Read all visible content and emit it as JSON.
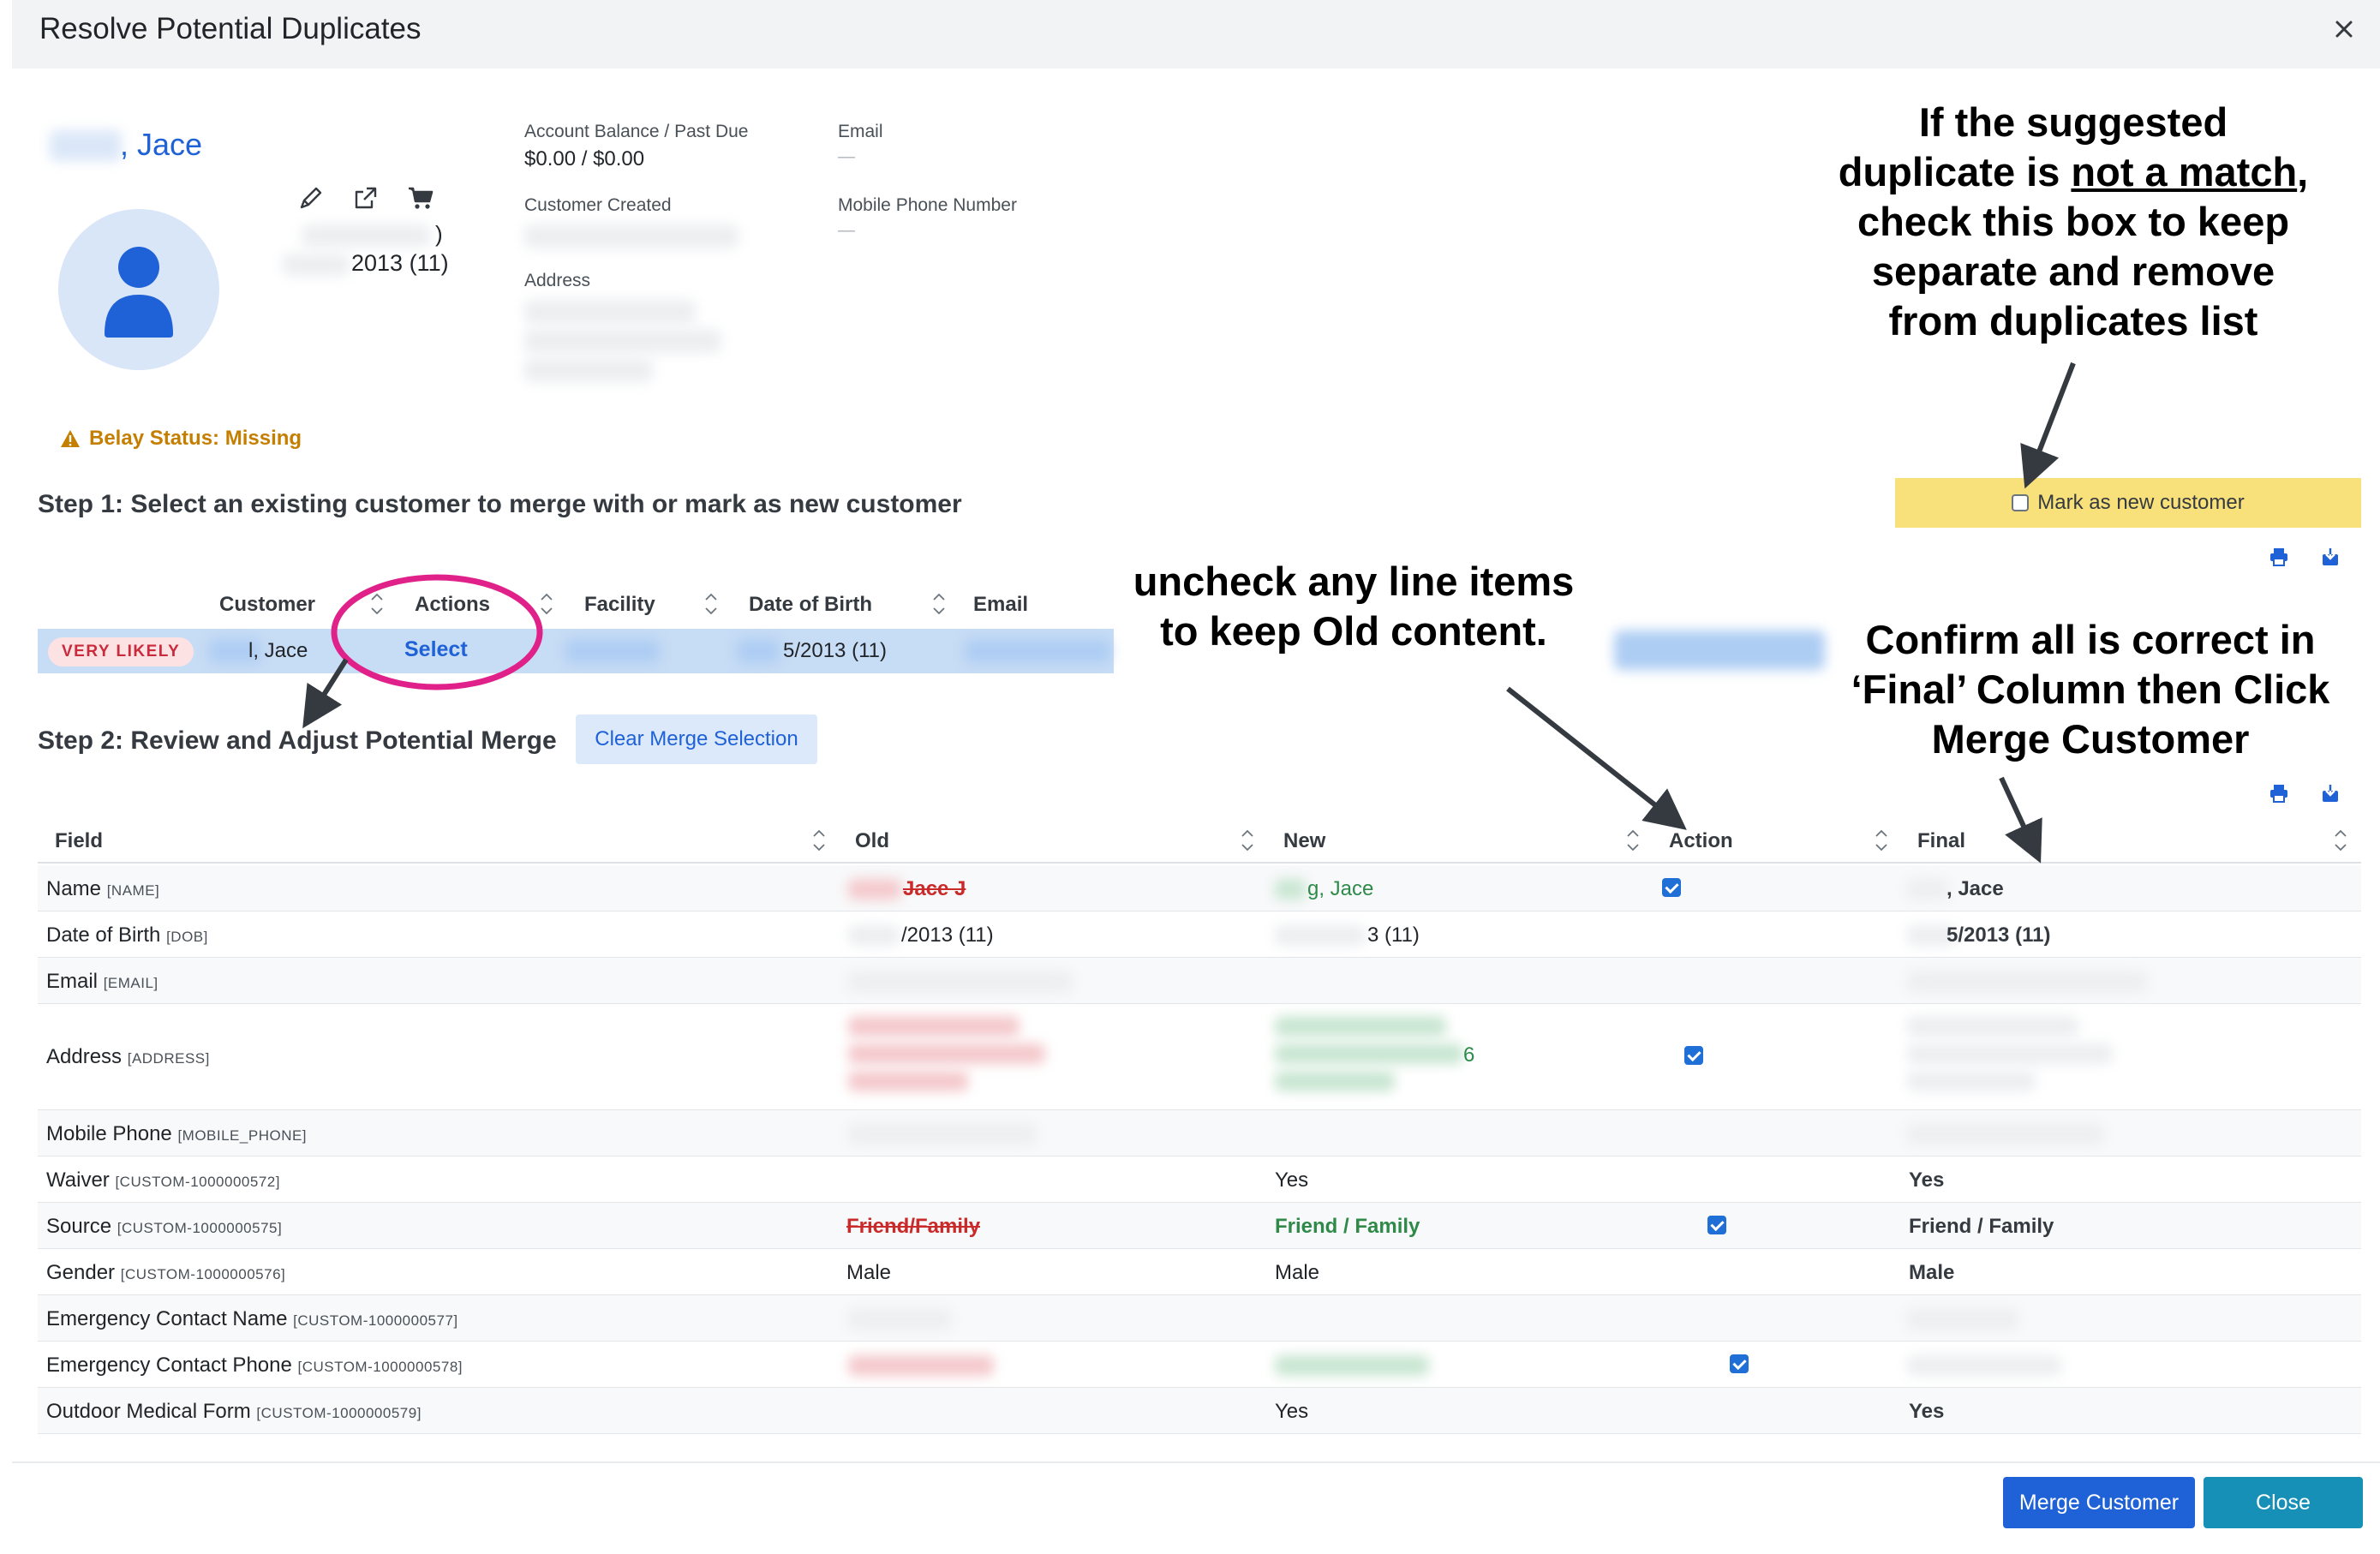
{
  "modal": {
    "title": "Resolve Potential Duplicates"
  },
  "profile": {
    "name_suffix": ", Jace",
    "dob_suffix": "2013 (11)",
    "paren": ")",
    "belay_status": "Belay Status: Missing"
  },
  "account": {
    "balance_label": "Account Balance / Past Due",
    "balance_value": "$0.00 / $0.00",
    "created_label": "Customer Created",
    "address_label": "Address",
    "email_label": "Email",
    "email_value": "—",
    "phone_label": "Mobile Phone Number",
    "phone_value": "—"
  },
  "icons": [
    "pencil-icon",
    "external-link-icon",
    "cart-icon",
    "close-icon",
    "user-icon",
    "warning-icon",
    "print-icon",
    "download-icon",
    "sort-icon"
  ],
  "colors": {
    "primary": "#1f61d6",
    "close_button": "#1790b8",
    "highlight": "#f8e07a",
    "warning": "#c47f00",
    "strike_red": "#c92a2a",
    "new_green": "#2f8a4a"
  },
  "step1": {
    "title": "Step 1: Select an existing customer to merge with or mark as new customer",
    "mark_new_label": "Mark as new customer",
    "columns": [
      "Customer",
      "Actions",
      "Facility",
      "Date of Birth",
      "Email"
    ],
    "row": {
      "badge": "VERY LIKELY",
      "customer": "l, Jace",
      "action": "Select",
      "dob": "5/2013 (11)"
    }
  },
  "step2": {
    "title": "Step 2: Review and Adjust Potential Merge",
    "clear_label": "Clear Merge Selection",
    "columns": [
      "Field",
      "Old",
      "New",
      "Action",
      "Final"
    ],
    "rows": [
      {
        "field": "Name",
        "code": "[NAME]",
        "old": "Jace J",
        "new": "g, Jace",
        "final": ", Jace"
      },
      {
        "field": "Date of Birth",
        "code": "[DOB]",
        "old": "/2013 (11)",
        "new": "3 (11)",
        "final": "5/2013 (11)"
      },
      {
        "field": "Email",
        "code": "[EMAIL]"
      },
      {
        "field": "Address",
        "code": "[ADDRESS]",
        "new": "6"
      },
      {
        "field": "Mobile Phone",
        "code": "[MOBILE_PHONE]"
      },
      {
        "field": "Waiver",
        "code": "[CUSTOM-1000000572]",
        "new": "Yes",
        "final": "Yes"
      },
      {
        "field": "Source",
        "code": "[CUSTOM-1000000575]",
        "old": "Friend/Family",
        "new": "Friend / Family",
        "final": "Friend / Family"
      },
      {
        "field": "Gender",
        "code": "[CUSTOM-1000000576]",
        "old": "Male",
        "new": "Male",
        "final": "Male"
      },
      {
        "field": "Emergency Contact Name",
        "code": "[CUSTOM-1000000577]"
      },
      {
        "field": "Emergency Contact Phone",
        "code": "[CUSTOM-1000000578]"
      },
      {
        "field": "Outdoor Medical Form",
        "code": "[CUSTOM-1000000579]",
        "new": "Yes",
        "final": "Yes"
      }
    ]
  },
  "annotations": {
    "mark_new_1": "If the suggested",
    "mark_new_2a": "duplicate is ",
    "mark_new_2b": "not a match",
    "mark_new_2c": ",",
    "mark_new_3": "check this box to keep",
    "mark_new_4": "separate and remove",
    "mark_new_5": "from duplicates list",
    "uncheck_1": "uncheck any line items",
    "uncheck_2": "to keep Old content.",
    "confirm_1": "Confirm all is correct in",
    "confirm_2": "‘Final’ Column then Click",
    "confirm_3": "Merge Customer"
  },
  "footer": {
    "merge_label": "Merge Customer",
    "close_label": "Close"
  }
}
